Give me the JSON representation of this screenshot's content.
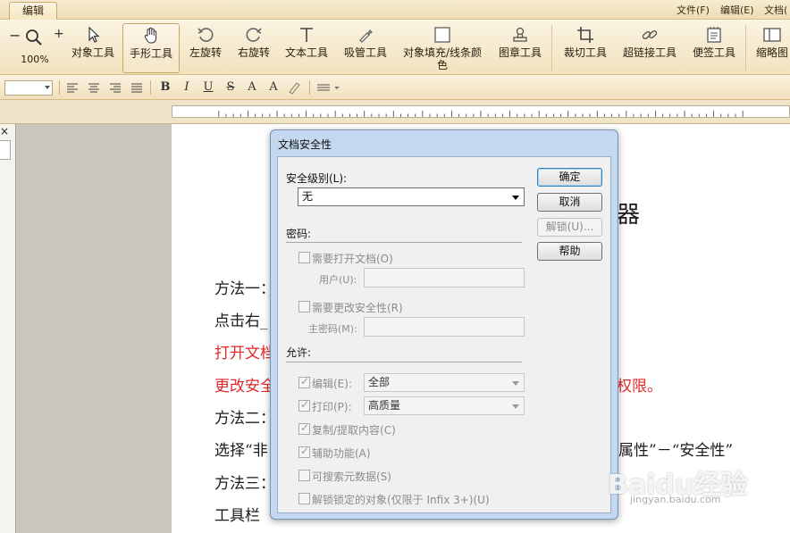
{
  "ribbon": {
    "active_tab": "编辑",
    "menus": [
      "文件(F)",
      "编辑(E)",
      "文档("
    ],
    "zoom_value": "100%",
    "tools": [
      {
        "label": "对象工具",
        "icon": "cursor-arrow-icon"
      },
      {
        "label": "手形工具",
        "icon": "hand-icon"
      },
      {
        "label": "左旋转",
        "icon": "rotate-left-icon"
      },
      {
        "label": "右旋转",
        "icon": "rotate-right-icon"
      },
      {
        "label": "文本工具",
        "icon": "text-t-icon"
      },
      {
        "label": "吸管工具",
        "icon": "eyedropper-icon"
      },
      {
        "label": "对象填充/线条颜",
        "label2": "色",
        "icon": "fill-square-icon"
      },
      {
        "label": "图章工具",
        "icon": "stamp-icon"
      },
      {
        "label": "裁切工具",
        "icon": "crop-icon"
      },
      {
        "label": "超链接工具",
        "icon": "link-icon"
      },
      {
        "label": "便签工具",
        "icon": "note-icon"
      },
      {
        "label": "缩略图",
        "icon": "thumbnail-icon"
      }
    ]
  },
  "format_bar": {
    "buttons": [
      "B",
      "I",
      "U",
      "S",
      "A",
      "A"
    ]
  },
  "document": {
    "lines": [
      {
        "text": "器",
        "red": false
      },
      {
        "text": "方法一：",
        "red": false
      },
      {
        "text": "点击右_",
        "red": false
      },
      {
        "text": "打开文档",
        "red": true
      },
      {
        "text": "更改安全",
        "red": true
      },
      {
        "text": "权限。",
        "red": true
      },
      {
        "text": "方法二：",
        "red": false
      },
      {
        "text": "选择“非",
        "red": false
      },
      {
        "text": "属性”－“安全性”",
        "red": false
      },
      {
        "text": "方法三：",
        "red": false
      },
      {
        "text": "工具栏",
        "red": false
      }
    ]
  },
  "dialog": {
    "title": "文档安全性",
    "security_level_label": "安全级别(L):",
    "security_level_value": "无",
    "password_group": "密码:",
    "require_open_label": "需要打开文档(O)",
    "user_label": "用户(U):",
    "require_change_label": "需要更改安全性(R)",
    "master_password_label": "主密码(M):",
    "permissions_group": "允许:",
    "edit_label": "编辑(E):",
    "edit_value": "全部",
    "print_label": "打印(P):",
    "print_value": "高质量",
    "copy_label": "复制/提取内容(C)",
    "accessibility_label": "辅助功能(A)",
    "searchable_metadata_label": "可搜索元数据(S)",
    "unlock_locked_objects_label": "解锁锁定的对象(仅限于 Infix 3+)(U)",
    "ok_button": "确定",
    "cancel_button": "取消",
    "unlock_button": "解锁(U)...",
    "help_button": "帮助"
  },
  "watermark": {
    "logo": "Baidu经验",
    "url": "jingyan.baidu.com"
  }
}
